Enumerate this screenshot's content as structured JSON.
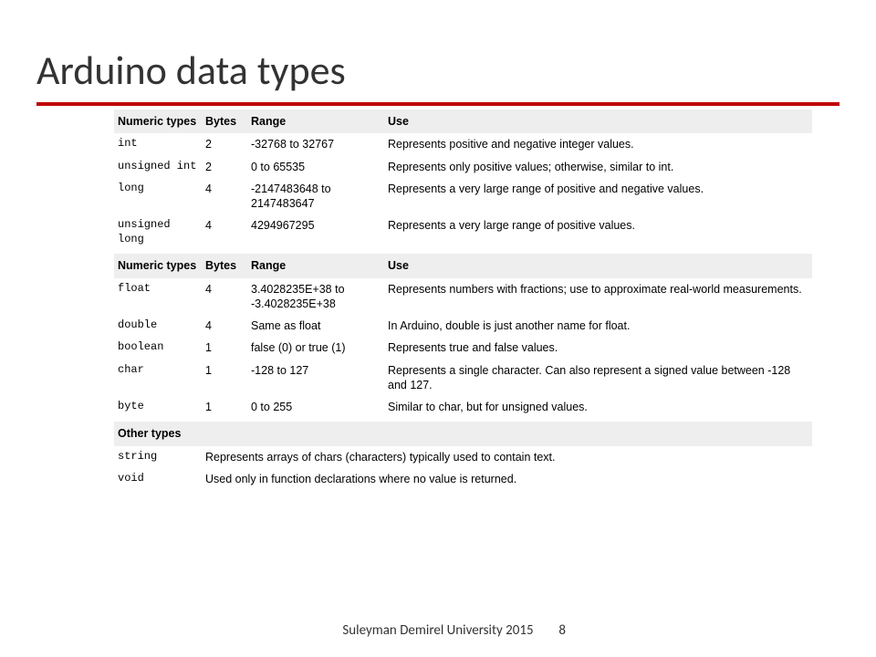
{
  "title": "Arduino data types",
  "headers": {
    "types": "Numeric types",
    "bytes": "Bytes",
    "range": "Range",
    "use": "Use",
    "other": "Other types"
  },
  "section1": [
    {
      "type": "int",
      "bytes": "2",
      "range": "-32768 to 32767",
      "use": "Represents positive and negative integer values."
    },
    {
      "type": "unsigned int",
      "bytes": "2",
      "range": "0 to 65535",
      "use": "Represents only positive values; otherwise, similar to int."
    },
    {
      "type": "long",
      "bytes": "4",
      "range": "-2147483648 to 2147483647",
      "use": "Represents a very large range of positive and negative values."
    },
    {
      "type": "unsigned long",
      "bytes": "4",
      "range": "4294967295",
      "use": "Represents a very large range of positive values."
    }
  ],
  "section2": [
    {
      "type": "float",
      "bytes": "4",
      "range": "3.4028235E+38 to -3.4028235E+38",
      "use": "Represents numbers with fractions; use to approximate real-world measurements."
    },
    {
      "type": "double",
      "bytes": "4",
      "range": "Same as float",
      "use": "In Arduino, double is just another name for float."
    },
    {
      "type": "boolean",
      "bytes": "1",
      "range": "false (0) or true (1)",
      "use": "Represents true and false values."
    },
    {
      "type": "char",
      "bytes": "1",
      "range": "-128 to 127",
      "use": "Represents a single character. Can also represent a signed value between -128 and 127."
    },
    {
      "type": "byte",
      "bytes": "1",
      "range": "0 to 255",
      "use": "Similar to char, but for unsigned values."
    }
  ],
  "section3": [
    {
      "type": "string",
      "use": "Represents arrays of chars (characters) typically used to contain text."
    },
    {
      "type": "void",
      "use": "Used only in function declarations where no value is returned."
    }
  ],
  "footer": "Suleyman Demirel University 2015",
  "page": "8"
}
